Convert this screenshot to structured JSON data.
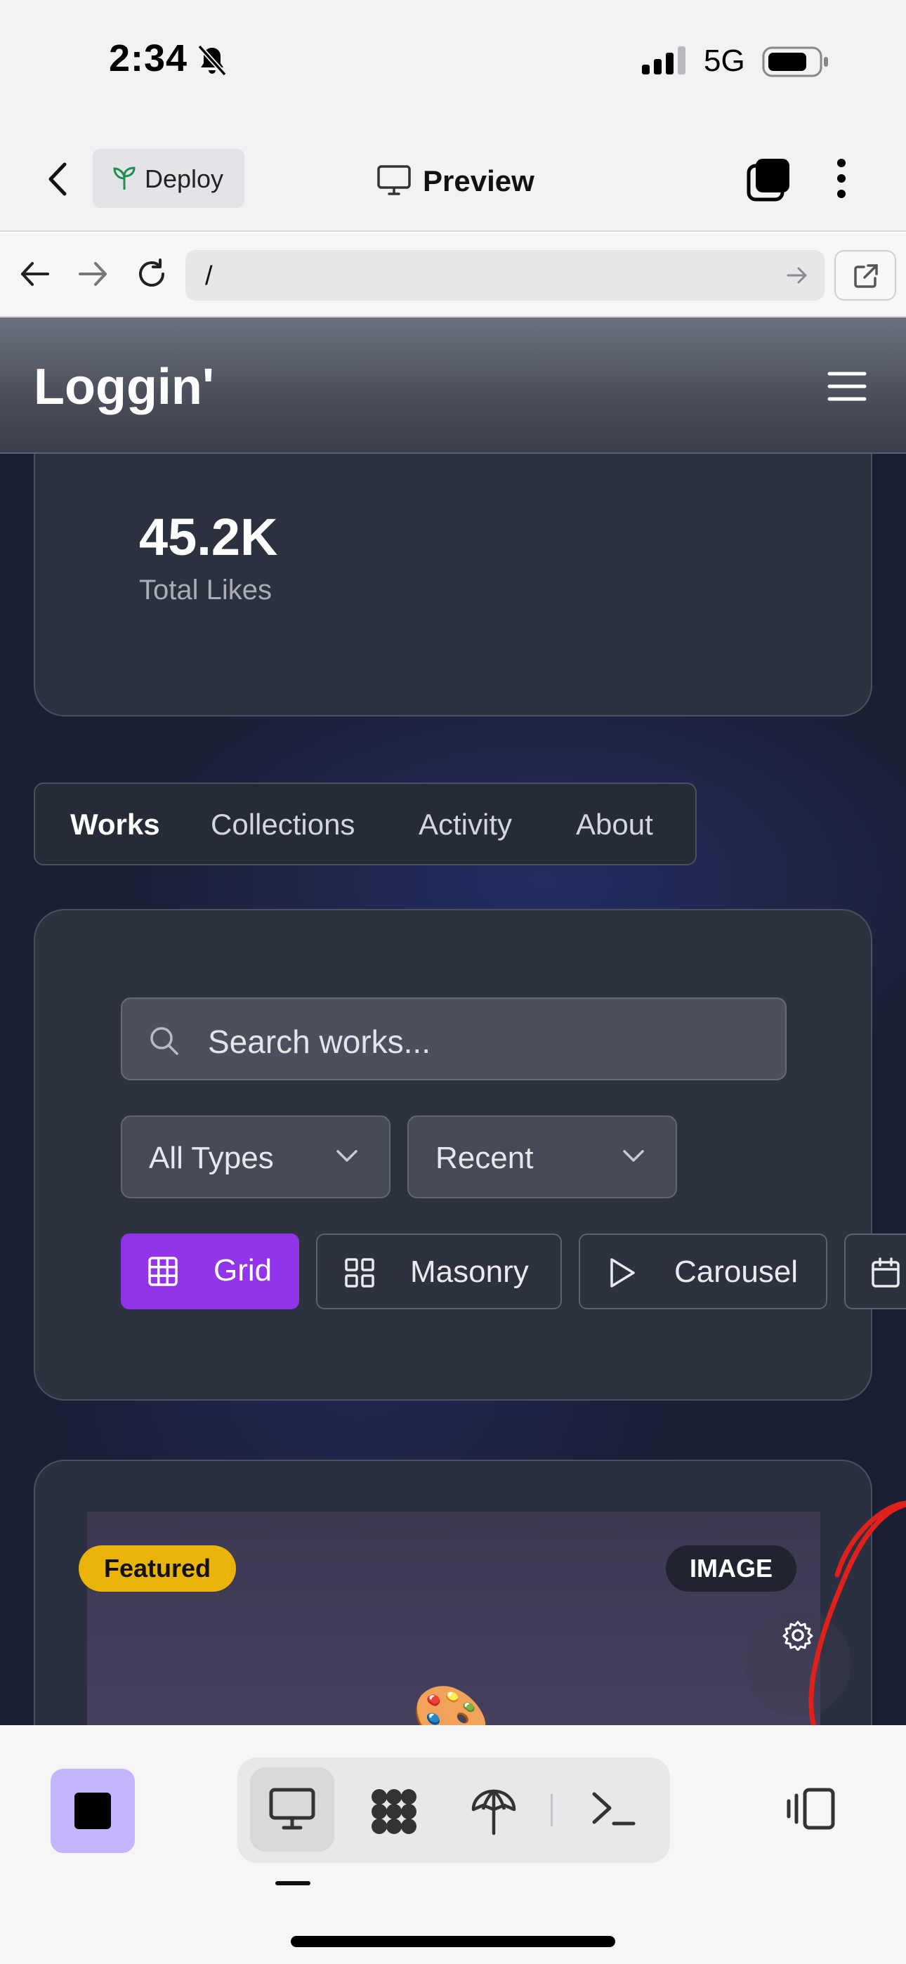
{
  "status_bar": {
    "time": "2:34",
    "network": "5G"
  },
  "app_header": {
    "deploy_label": "Deploy",
    "title": "Preview"
  },
  "url_bar": {
    "url": "/"
  },
  "site": {
    "logo": "Loggin'",
    "stats": {
      "value": "45.2K",
      "label": "Total Likes"
    },
    "tabs": [
      "Works",
      "Collections",
      "Activity",
      "About"
    ],
    "active_tab": "Works",
    "search": {
      "placeholder": "Search works..."
    },
    "filters": {
      "type": "All Types",
      "sort": "Recent"
    },
    "views": [
      "Grid",
      "Masonry",
      "Carousel"
    ],
    "active_view": "Grid",
    "work": {
      "featured_badge": "Featured",
      "type_badge": "IMAGE"
    }
  },
  "colors": {
    "accent": "#9234ea",
    "featured": "#eab308",
    "stop_button": "#c4b5fd",
    "annotation": "#e0201b"
  },
  "icons": [
    "bell-slash-icon",
    "signal-icon",
    "battery-icon",
    "chevron-left-icon",
    "sprout-icon",
    "monitor-icon",
    "tabs-icon",
    "more-vertical-icon",
    "arrow-left-icon",
    "arrow-right-icon",
    "reload-icon",
    "external-link-icon",
    "hamburger-icon",
    "search-icon",
    "chevron-down-icon",
    "grid-icon",
    "masonry-icon",
    "play-icon",
    "calendar-icon",
    "gear-icon",
    "palette-icon",
    "stop-icon",
    "desktop-icon",
    "apps-icon",
    "deploy-icon",
    "terminal-icon",
    "device-switch-icon"
  ]
}
